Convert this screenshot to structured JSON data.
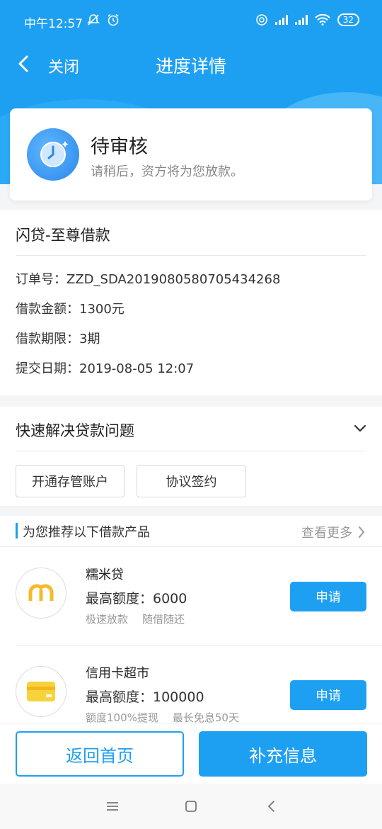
{
  "status_bar": {
    "time": "中午12:57",
    "battery": "32"
  },
  "nav": {
    "close_label": "关闭",
    "title": "进度详情"
  },
  "status_card": {
    "title": "待审核",
    "subtitle": "请稍后，资方将为您放款。"
  },
  "order": {
    "product_name": "闪贷-至尊借款",
    "rows": [
      "订单号：ZZD_SDA2019080580705434268",
      "借款金额：1300元",
      "借款期限：3期",
      "提交日期：2019-08-05 12:07"
    ]
  },
  "quick": {
    "title": "快速解决贷款问题",
    "buttons": [
      "开通存管账户",
      "协议签约"
    ]
  },
  "recommend": {
    "title": "为您推荐以下借款产品",
    "more": "查看更多",
    "loans": [
      {
        "name": "糯米贷",
        "limit": "最高额度：6000",
        "tags": [
          "极速放款",
          "随借随还"
        ],
        "apply": "申请",
        "icon": "nuomi-logo-icon"
      },
      {
        "name": "信用卡超市",
        "limit": "最高额度：100000",
        "tags": [
          "额度100%提现",
          "最长免息50天"
        ],
        "apply": "申请",
        "icon": "credit-card-icon"
      }
    ]
  },
  "bottom": {
    "home_label": "返回首页",
    "info_label": "补充信息"
  },
  "colors": {
    "primary": "#1ea0f2",
    "accent_yellow": "#f7b928"
  }
}
